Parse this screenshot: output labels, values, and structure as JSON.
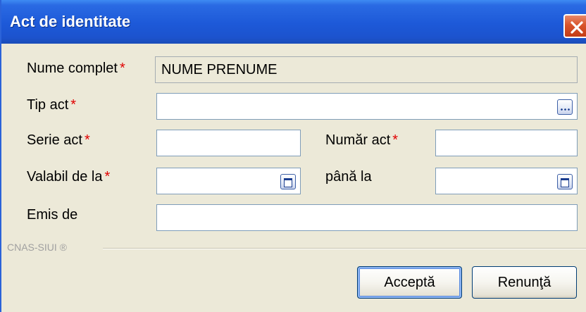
{
  "window": {
    "title": "Act de identitate"
  },
  "form": {
    "nume_complet": {
      "label": "Nume complet",
      "value": "NUME PRENUME"
    },
    "tip_act": {
      "label": "Tip act",
      "value": ""
    },
    "serie_act": {
      "label": "Serie act",
      "value": ""
    },
    "numar_act": {
      "label": "Număr act",
      "value": ""
    },
    "valabil_de_la": {
      "label": "Valabil de la",
      "value": ""
    },
    "pana_la": {
      "label": "până la",
      "value": ""
    },
    "emis_de": {
      "label": "Emis de",
      "value": ""
    },
    "required_mark": "*"
  },
  "footer": {
    "brand": "CNAS-SIUI ®"
  },
  "buttons": {
    "accept": "Acceptă",
    "cancel": "Renunţă"
  },
  "icons": {
    "close": "close-icon",
    "lookup": "ellipsis-icon",
    "calendar": "calendar-icon"
  },
  "colors": {
    "titlebar": "#1D59D8",
    "close": "#D9542C",
    "required": "#E00000",
    "background": "#ECE9D8"
  }
}
